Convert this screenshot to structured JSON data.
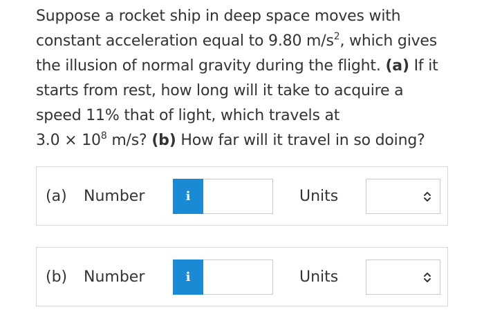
{
  "question": {
    "line1": "Suppose a rocket ship in deep space moves with",
    "line2_pre": "constant acceleration equal to 9.80 m/s",
    "line2_sup": "2",
    "line2_post": ", which gives",
    "line3_pre": "the illusion of normal gravity during the flight. ",
    "line3_bold": "(a)",
    "line3_post": " If it",
    "line4": "starts from rest, how long will it take to acquire a",
    "line5": "speed 11% that of light, which travels at",
    "line6_pre": "3.0 × 10",
    "line6_sup": "8",
    "line6_mid": " m/s? ",
    "line6_bold": "(b)",
    "line6_post": " How far will it travel in so doing?"
  },
  "parts": [
    {
      "label": "(a)",
      "number_label": "Number",
      "info_icon": "i",
      "number_value": "",
      "units_label": "Units",
      "units_value": ""
    },
    {
      "label": "(b)",
      "number_label": "Number",
      "info_icon": "i",
      "number_value": "",
      "units_label": "Units",
      "units_value": ""
    }
  ],
  "colors": {
    "info_button": "#1a8ad4",
    "text": "#333333",
    "border": "#d6d6d6"
  }
}
